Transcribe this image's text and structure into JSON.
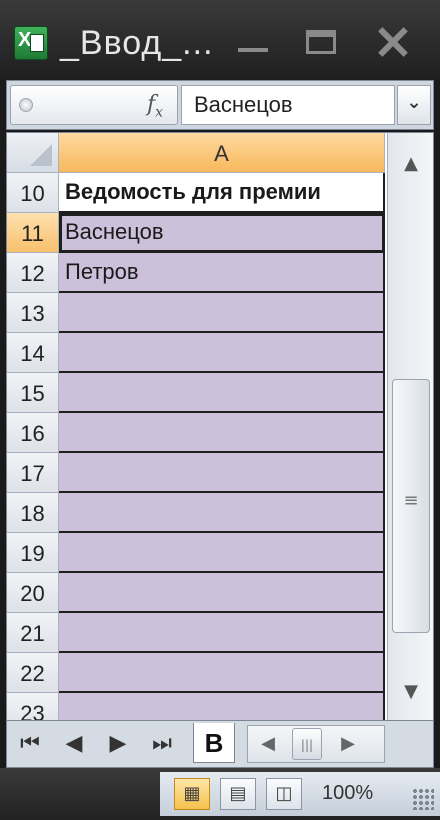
{
  "window": {
    "title": "_Ввод_...",
    "app_icon": "excel-icon"
  },
  "formula_bar": {
    "fx_label": "fx",
    "value": "Васнецов"
  },
  "sheet": {
    "column_header": "A",
    "rows": [
      {
        "num": "10",
        "value": "Ведомость для премии",
        "style": "header"
      },
      {
        "num": "11",
        "value": "Васнецов",
        "style": "selected"
      },
      {
        "num": "12",
        "value": "Петров",
        "style": "normal"
      },
      {
        "num": "13",
        "value": "",
        "style": "normal"
      },
      {
        "num": "14",
        "value": "",
        "style": "normal"
      },
      {
        "num": "15",
        "value": "",
        "style": "normal"
      },
      {
        "num": "16",
        "value": "",
        "style": "normal"
      },
      {
        "num": "17",
        "value": "",
        "style": "normal"
      },
      {
        "num": "18",
        "value": "",
        "style": "normal"
      },
      {
        "num": "19",
        "value": "",
        "style": "normal"
      },
      {
        "num": "20",
        "value": "",
        "style": "normal"
      },
      {
        "num": "21",
        "value": "",
        "style": "normal"
      },
      {
        "num": "22",
        "value": "",
        "style": "normal"
      },
      {
        "num": "23",
        "value": "",
        "style": "normal"
      }
    ]
  },
  "sheet_tabs": {
    "active_tab": "В"
  },
  "status_bar": {
    "zoom": "100%"
  },
  "colors": {
    "cell_fill": "#ccc0da",
    "column_header": "#f7b85c",
    "title_bar": "#2a2a2a"
  }
}
